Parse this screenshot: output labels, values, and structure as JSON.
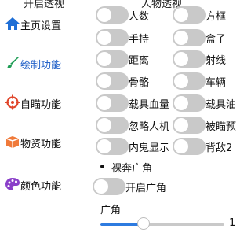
{
  "header_cut": {
    "left": "开启透视",
    "right": "人物透视"
  },
  "sidebar": {
    "items": [
      {
        "label": "主页设置",
        "icon": "home-icon"
      },
      {
        "label": "绘制功能",
        "icon": "brush-icon",
        "active": true
      },
      {
        "label": "自瞄功能",
        "icon": "crosshair-icon"
      },
      {
        "label": "物资功能",
        "icon": "box-icon"
      },
      {
        "label": "颜色功能",
        "icon": "palette-icon"
      }
    ]
  },
  "toggles_left": [
    "人数",
    "手持",
    "距离",
    "骨骼",
    "载具血量",
    "忽略人机",
    "内鬼显示"
  ],
  "toggles_right": [
    "方框",
    "盒子",
    "射线",
    "车辆",
    "载具油",
    "被瞄预",
    "背敌2"
  ],
  "section": {
    "title": "裸奔广角",
    "toggle_label": "开启广角",
    "slider_label": "广角",
    "slider_value_text": "1",
    "slider_fraction": 0.35
  },
  "colors": {
    "accent": "#2563c9",
    "switch_off": "#c9c9c9",
    "slider_fill": "#2d7be0"
  }
}
